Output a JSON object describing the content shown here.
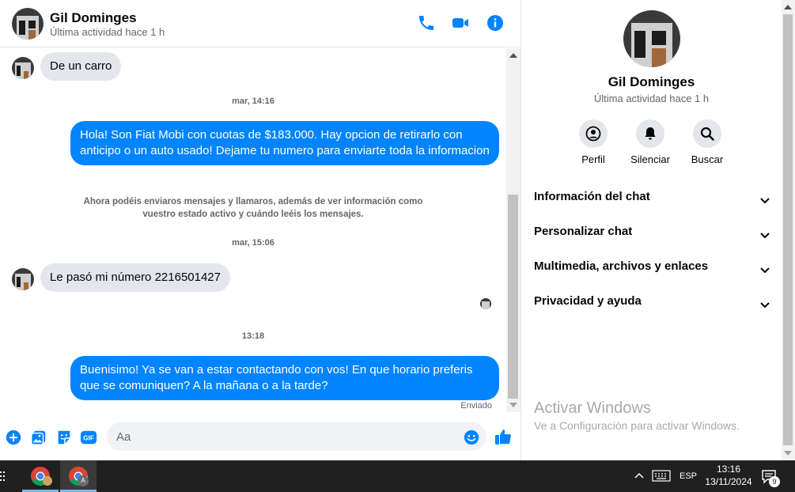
{
  "header": {
    "name": "Gil Dominges",
    "status": "Última actividad hace 1 h"
  },
  "messages": [
    {
      "type": "incoming",
      "text": "De un carro"
    },
    {
      "type": "timestamp",
      "text": "mar, 14:16"
    },
    {
      "type": "outgoing",
      "text": "Hola! Son Fiat Mobi con cuotas de $183.000. Hay opcion de retirarlo con anticipo o un auto usado! Dejame tu numero para enviarte toda la informacion"
    },
    {
      "type": "notice",
      "text": "Ahora podéis enviaros mensajes y llamaros, además de ver información como vuestro estado activo y cuándo leéis los mensajes."
    },
    {
      "type": "timestamp",
      "text": "mar, 15:06"
    },
    {
      "type": "incoming",
      "text": "Le pasó mi número 2216501427"
    },
    {
      "type": "timestamp",
      "text": "13:18"
    },
    {
      "type": "outgoing",
      "text": "Buenisimo! Ya se van a estar contactando con vos! En que horario preferis que se comuniquen? A la mañana o a la tarde?"
    },
    {
      "type": "receipt",
      "text": "Enviado"
    }
  ],
  "composer": {
    "placeholder": "Aa"
  },
  "info": {
    "name": "Gil Dominges",
    "status": "Última actividad hace 1 h",
    "actions": [
      "Perfil",
      "Silenciar",
      "Buscar"
    ],
    "sections": [
      "Información del chat",
      "Personalizar chat",
      "Multimedia, archivos y enlaces",
      "Privacidad y ayuda"
    ],
    "watermark_title": "Activar Windows",
    "watermark_sub": "Ve a Configuración para activar Windows."
  },
  "taskbar": {
    "lang": "ESP",
    "time": "13:16",
    "date": "13/11/2024",
    "notif_count": "9"
  },
  "colors": {
    "accent": "#0084ff",
    "bubble_in": "#e4e6eb",
    "taskbar": "#202020"
  }
}
